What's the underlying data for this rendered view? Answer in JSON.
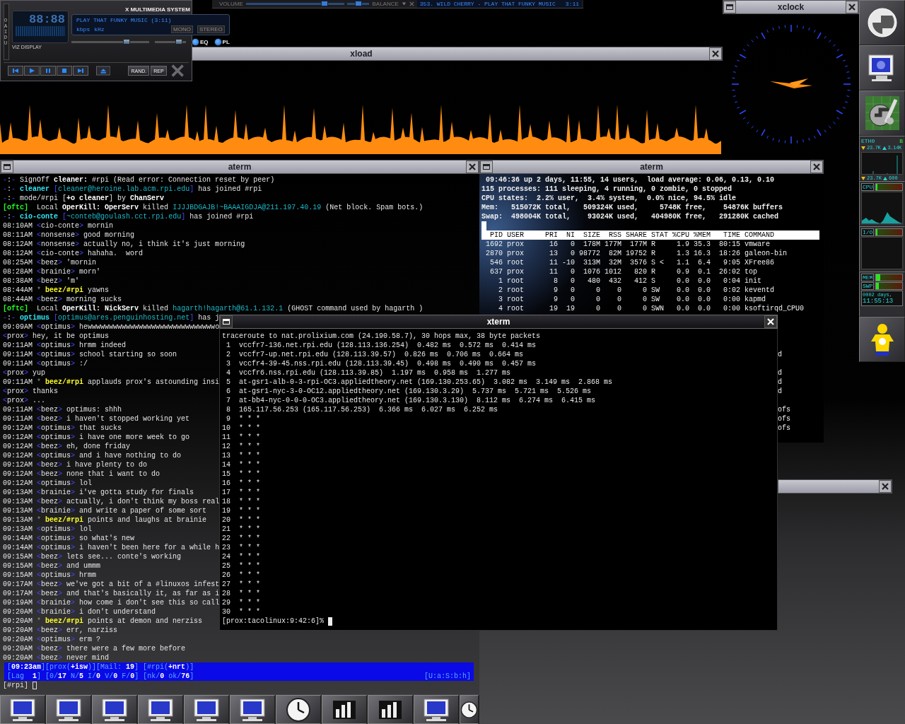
{
  "player_bar": {
    "volume_label": "VOLUME",
    "volume": {
      "level": 0.8
    },
    "balance_label": "BALANCE",
    "balance": {
      "level": 0.5
    },
    "track": "353. WILD CHERRY - PLAY THAT FUNKY MUSIC",
    "track_time": "3:11"
  },
  "xmms": {
    "side_label": "OAIDU",
    "time": "88:88",
    "viz_label": "VIZ DISPLAY",
    "title": "X MULTIMEDIA SYSTEM",
    "song": "PLAY THAT FUNKY MUSIC (3:11)",
    "bitrate_unit": "kbps",
    "samplerate_unit": "kHz",
    "mono": {
      "label": "MONO",
      "on": false
    },
    "stereo": {
      "label": "STEREO",
      "on": false
    },
    "volume": {
      "level": 0.71
    },
    "balance": {
      "level": 0.78
    },
    "toggles": [
      {
        "label": "EQ",
        "on": true
      },
      {
        "label": "PL",
        "on": true
      }
    ],
    "shuffle": "RAND.",
    "repeat": "REP"
  },
  "xload": {
    "title": "xload",
    "focused": false
  },
  "xclock": {
    "title": "xclock",
    "focused": false
  },
  "dock": {
    "network": {
      "interface": "ETH0",
      "indicator": "B",
      "rx_rate": "23.7K",
      "tx_rate": "3.14K",
      "rx_peak": "23.7K",
      "tx_peak": "600"
    },
    "meters": [
      {
        "kind": "cpu",
        "label": "CPU",
        "level": 0.04
      },
      {
        "kind": "io",
        "label": "I/O",
        "level": 0.04
      }
    ],
    "memory": [
      {
        "label": "MEM",
        "level": 0.14
      },
      {
        "label": "SWP",
        "level": 0.1
      }
    ],
    "uptime_days": "0002 days,",
    "uptime_clock": "11:55:13"
  },
  "irc_term": {
    "title": "aterm",
    "focused": false,
    "lines": [
      {
        "kind": "event",
        "marker": "-:-",
        "text": "SignOff **cleaner:** #rpi (Read error: Connection reset by peer)"
      },
      {
        "kind": "join",
        "marker": "-:-",
        "nick": "cleaner",
        "host": "[cleaner@heroine.lab.acm.rpi.edu]",
        "text": "has joined #rpi"
      },
      {
        "kind": "event",
        "marker": "-:-",
        "text": "mode/#rpi [**+o cleaner**] by **ChanServ**"
      },
      {
        "kind": "notice",
        "tag": "[oftc]",
        "text": "Local **OperKill:** **OperServ** killed",
        "target": "IJJJBDGAJB!~BAAAIGDJA@211.197.40.19",
        "reason": "(Net block. Spam bots.)"
      },
      {
        "kind": "join",
        "marker": "-:-",
        "nick": "cio-conte",
        "host": "[~conteb@goulash.cct.rpi.edu]",
        "text": "has joined #rpi"
      },
      {
        "kind": "message",
        "time": "08:10AM",
        "nick": "<cio-conte>",
        "text": "mornin"
      },
      {
        "kind": "message",
        "time": "08:11AM",
        "nick": "<nonsense>",
        "text": "good morning"
      },
      {
        "kind": "message",
        "time": "08:12AM",
        "nick": "<nonsense>",
        "text": "actually no, i think it's just morning"
      },
      {
        "kind": "message",
        "time": "08:12AM",
        "nick": "<cio-conte>",
        "text": "hahaha.  word"
      },
      {
        "kind": "message",
        "time": "08:25AM",
        "nick": "<beez>",
        "text": "'mornin"
      },
      {
        "kind": "message",
        "time": "08:28AM",
        "nick": "<brainie>",
        "text": "morn'"
      },
      {
        "kind": "message",
        "time": "08:38AM",
        "nick": "<beez>",
        "text": "'m'"
      },
      {
        "kind": "action",
        "time": "08:44AM",
        "marker": "*",
        "nick": "beez/#rpi",
        "text": "yawns"
      },
      {
        "kind": "message",
        "time": "08:44AM",
        "nick": "<beez>",
        "text": "morning sucks"
      },
      {
        "kind": "notice",
        "tag": "[oftc]",
        "text": "Local **OperKill:** **NickServ** killed",
        "target": "hagarth!hagarth@61.1.132.1",
        "reason": "(GHOST command used by hagarth )"
      },
      {
        "kind": "join",
        "marker": "-:-",
        "nick": "optimus",
        "host": "[optimus@ares.penguinhosting.net]",
        "text": "has j"
      },
      {
        "kind": "message",
        "time": "09:09AM",
        "nick": "<optimus>",
        "text": "hewwwwwwwwwwwwwwwwwwwwwwwwwwwwwwo"
      },
      {
        "kind": "message",
        "nick": "<prox>",
        "text": "hey, it be optimus"
      },
      {
        "kind": "message",
        "time": "09:11AM",
        "nick": "<optimus>",
        "text": "hrmm indeed"
      },
      {
        "kind": "message",
        "time": "09:11AM",
        "nick": "<optimus>",
        "text": "school starting so soon"
      },
      {
        "kind": "message",
        "time": "09:11AM",
        "nick": "<optimus>",
        "text": ":/"
      },
      {
        "kind": "message",
        "nick": "<prox>",
        "text": "yup"
      },
      {
        "kind": "action",
        "time": "09:11AM",
        "marker": "*",
        "nick": "beez/#rpi",
        "text": "applauds prox's astounding insi"
      },
      {
        "kind": "message",
        "nick": "<prox>",
        "text": "thanks"
      },
      {
        "kind": "message",
        "nick": "<prox>",
        "text": "..."
      },
      {
        "kind": "message",
        "time": "09:11AM",
        "nick": "<beez>",
        "text": "optimus: shhh"
      },
      {
        "kind": "message",
        "time": "09:11AM",
        "nick": "<beez>",
        "text": "i haven't stopped working yet"
      },
      {
        "kind": "message",
        "time": "09:12AM",
        "nick": "<optimus>",
        "text": "that sucks"
      },
      {
        "kind": "message",
        "time": "09:12AM",
        "nick": "<optimus>",
        "text": "i have one more week to go"
      },
      {
        "kind": "message",
        "time": "09:12AM",
        "nick": "<beez>",
        "text": "eh, done friday"
      },
      {
        "kind": "message",
        "time": "09:12AM",
        "nick": "<optimus>",
        "text": "and i have nothing to do"
      },
      {
        "kind": "message",
        "time": "09:12AM",
        "nick": "<beez>",
        "text": "i have plenty to do"
      },
      {
        "kind": "message",
        "time": "09:12AM",
        "nick": "<beez>",
        "text": "none that i want to do"
      },
      {
        "kind": "message",
        "time": "09:12AM",
        "nick": "<optimus>",
        "text": "lol"
      },
      {
        "kind": "message",
        "time": "09:13AM",
        "nick": "<brainie>",
        "text": "i've gotta study for finals"
      },
      {
        "kind": "message",
        "time": "09:13AM",
        "nick": "<beez>",
        "text": "actually, i don't think my boss real"
      },
      {
        "kind": "message",
        "time": "09:13AM",
        "nick": "<brainie>",
        "text": "and write a paper of some sort"
      },
      {
        "kind": "action",
        "time": "09:13AM",
        "marker": "*",
        "nick": "beez/#rpi",
        "text": "points and laughs at brainie"
      },
      {
        "kind": "message",
        "time": "09:13AM",
        "nick": "<optimus>",
        "text": "lol"
      },
      {
        "kind": "message",
        "time": "09:14AM",
        "nick": "<optimus>",
        "text": "so what's new"
      },
      {
        "kind": "message",
        "time": "09:14AM",
        "nick": "<optimus>",
        "text": "i haven't been here for a while h"
      },
      {
        "kind": "message",
        "time": "09:15AM",
        "nick": "<beez>",
        "text": "lets see... conte's working"
      },
      {
        "kind": "message",
        "time": "09:15AM",
        "nick": "<beez>",
        "text": "and ummm"
      },
      {
        "kind": "message",
        "time": "09:15AM",
        "nick": "<optimus>",
        "text": "hrmm"
      },
      {
        "kind": "message",
        "time": "09:17AM",
        "nick": "<beez>",
        "text": "we've got a bit of a #linuxos infest"
      },
      {
        "kind": "message",
        "time": "09:17AM",
        "nick": "<beez>",
        "text": "and that's basically it, as far as i"
      },
      {
        "kind": "message",
        "time": "09:19AM",
        "nick": "<brainie>",
        "text": "how come i don't see this so call"
      },
      {
        "kind": "message",
        "time": "09:20AM",
        "nick": "<brainie>",
        "text": "i don't understand"
      },
      {
        "kind": "action",
        "time": "09:20AM",
        "marker": "*",
        "nick": "beez/#rpi",
        "text": "points at demon and nerziss"
      },
      {
        "kind": "message",
        "time": "09:20AM",
        "nick": "<beez>",
        "text": "err, narziss"
      },
      {
        "kind": "message",
        "time": "09:20AM",
        "nick": "<optimus>",
        "text": "erm ?"
      },
      {
        "kind": "message",
        "time": "09:20AM",
        "nick": "<beez>",
        "text": "there were a few more before"
      },
      {
        "kind": "message",
        "time": "09:20AM",
        "nick": "<beez>",
        "text": "never mind"
      }
    ],
    "status": [
      "[**09:23am**][prox(**+isw**)][Mail: **19**] [#rpi(**+nrt**)]",
      "[Lag  **1**] [0/**17** N/**5** I/**0** V/**0** F/**0**] [nk/**0** ok/**76**]"
    ],
    "status_right": "[U:a:S:b:h]",
    "prompt": "[#rpi]"
  },
  "top_term": {
    "title": "aterm",
    "focused": false,
    "summary": [
      " 09:46:36 up 2 days, 11:55, 14 users,  load average: 0.06, 0.13, 0.10",
      "115 processes: 111 sleeping, 4 running, 0 zombie, 0 stopped",
      "CPU states:  2.2% user,  3.4% system,  0.0% nice, 94.5% idle",
      "Mem:   515072K total,   509324K used,     5748K free,    54876K buffers",
      "Swap:  498004K total,    93024K used,   404980K free,   291280K cached"
    ],
    "header": "  PID USER     PRI  NI  SIZE  RSS SHARE STAT %CPU %MEM   TIME COMMAND",
    "rows": [
      " 1692 prox      16   0  178M 177M  177M R     1.9 35.3  80:15 vmware",
      " 2870 prox      13   0 98772  82M 19752 R     1.3 16.3  18:26 galeon-bin",
      "  546 root      11 -10  313M  32M  3576 S <   1.1  6.4   9:05 XFree86",
      "  637 prox      11   0  1076 1012   820 R     0.9  0.1  26:02 top",
      "    1 root       8   0   480  432   412 S     0.0  0.0   0:04 init",
      "    2 root       9   0     0    0     0 SW    0.0  0.0   0:02 keventd",
      "    3 root       9   0     0    0     0 SW    0.0  0.0   0:00 kapmd",
      "    4 root      19  19     0    0     0 SWN   0.0  0.0   0:00 ksoftirqd_CPU0"
    ],
    "hidden_tails": [
      {
        "kind": "blank"
      },
      {
        "kind": "blank"
      },
      {
        "kind": "blank"
      },
      {
        "kind": "blank"
      },
      {
        "kind": "text",
        "text": "d"
      },
      {
        "kind": "blank"
      },
      {
        "kind": "text",
        "text": "d"
      },
      {
        "kind": "text",
        "text": "d"
      },
      {
        "kind": "text",
        "text": "d"
      },
      {
        "kind": "blank"
      },
      {
        "kind": "text",
        "text": "ofs"
      },
      {
        "kind": "text",
        "text": "ofs"
      },
      {
        "kind": "text",
        "text": "ofs"
      }
    ]
  },
  "trace_term": {
    "title": "xterm",
    "focused": true,
    "lines": [
      "traceroute to nat.prolixium.com (24.190.58.7), 30 hops max, 38 byte packets",
      " 1  vccfr7-136.net.rpi.edu (128.113.136.254)  0.482 ms  0.572 ms  0.414 ms",
      " 2  vccfr7-up.net.rpi.edu (128.113.39.57)  0.826 ms  0.706 ms  0.664 ms",
      " 3  vccfr4-39-45.nss.rpi.edu (128.113.39.45)  0.498 ms  0.490 ms  0.457 ms",
      " 4  vccfr6.nss.rpi.edu (128.113.39.85)  1.197 ms  0.958 ms  1.277 ms",
      " 5  at-gsr1-alb-0-3-rpi-OC3.appliedtheory.net (169.130.253.65)  3.082 ms  3.149 ms  2.868 ms",
      " 6  at-gsr1-nyc-3-0-OC12.appliedtheory.net (169.130.3.29)  5.737 ms  5.721 ms  5.526 ms",
      " 7  at-bb4-nyc-0-0-0-OC3.appliedtheory.net (169.130.3.130)  8.112 ms  6.274 ms  6.415 ms",
      " 8  165.117.56.253 (165.117.56.253)  6.366 ms  6.027 ms  6.252 ms",
      " 9  * * *",
      "10  * * *",
      "11  * * *",
      "12  * * *",
      "13  * * *",
      "14  * * *",
      "15  * * *",
      "16  * * *",
      "17  * * *",
      "18  * * *",
      "19  * * *",
      "20  * * *",
      "21  * * *",
      "22  * * *",
      "23  * * *",
      "24  * * *",
      "25  * * *",
      "26  * * *",
      "27  * * *",
      "28  * * *",
      "29  * * *",
      "30  * * *"
    ],
    "prompt": "[prox:tacolinux:9:42:6]%"
  }
}
